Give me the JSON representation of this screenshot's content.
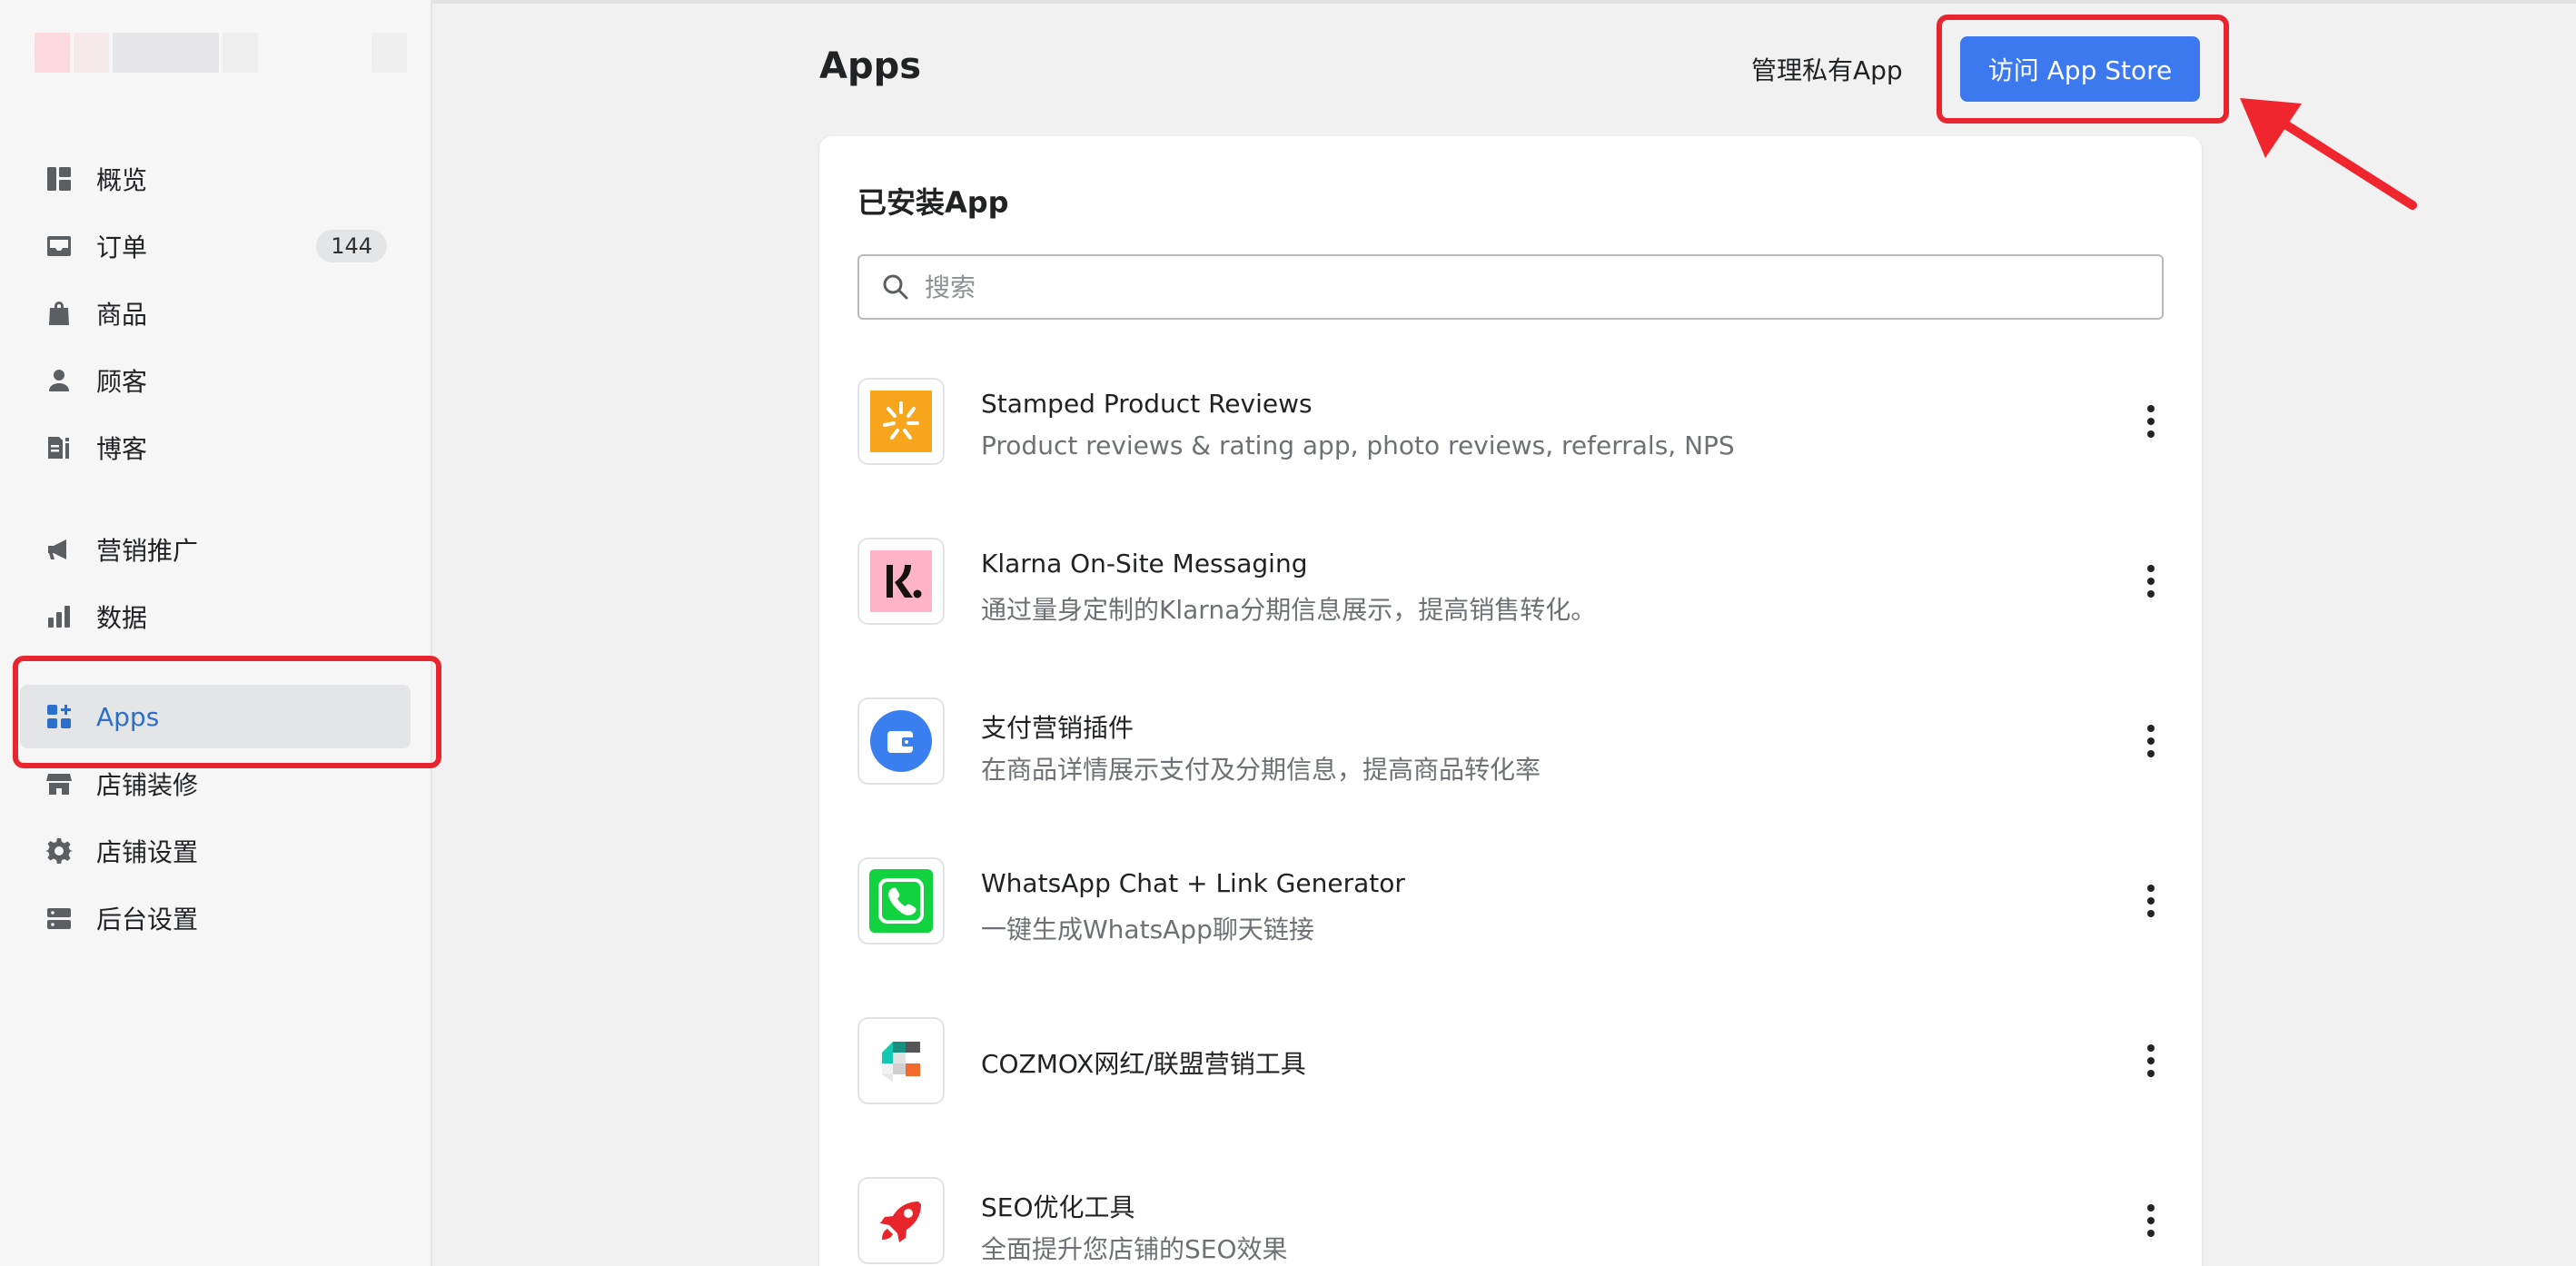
{
  "sidebar": {
    "items": [
      {
        "label": "概览",
        "icon": "overview-icon"
      },
      {
        "label": "订单",
        "icon": "inbox-icon",
        "badge": "144"
      },
      {
        "label": "商品",
        "icon": "shopping-bag-icon"
      },
      {
        "label": "顾客",
        "icon": "person-icon"
      },
      {
        "label": "博客",
        "icon": "blog-icon"
      },
      {
        "label": "营销推广",
        "icon": "megaphone-icon"
      },
      {
        "label": "数据",
        "icon": "bar-chart-icon"
      },
      {
        "label": "Apps",
        "icon": "apps-icon",
        "active": true
      },
      {
        "label": "店铺装修",
        "icon": "storefront-icon"
      },
      {
        "label": "店铺设置",
        "icon": "gear-icon"
      },
      {
        "label": "后台设置",
        "icon": "server-icon"
      }
    ]
  },
  "header": {
    "title": "Apps",
    "manage_link": "管理私有App",
    "store_button": "访问 App Store"
  },
  "installed": {
    "title": "已安装App",
    "search_placeholder": "搜索",
    "apps": [
      {
        "name": "Stamped Product Reviews",
        "desc": "Product reviews & rating app, photo reviews, referrals, NPS",
        "icon": "stamped-icon"
      },
      {
        "name": "Klarna On-Site Messaging",
        "desc": "通过量身定制的Klarna分期信息展示，提高销售转化。",
        "icon": "klarna-icon"
      },
      {
        "name": "支付营销插件",
        "desc": "在商品详情展示支付及分期信息，提高商品转化率",
        "icon": "wallet-icon"
      },
      {
        "name": "WhatsApp Chat + Link Generator",
        "desc": "一键生成WhatsApp聊天链接",
        "icon": "whatsapp-phone-icon"
      },
      {
        "name": "COZMOX网红/联盟营销工具",
        "desc": "",
        "icon": "cozmox-icon"
      },
      {
        "name": "SEO优化工具",
        "desc": "全面提升您店铺的SEO效果",
        "icon": "rocket-icon"
      }
    ]
  },
  "colors": {
    "accent": "#3c78ee",
    "highlight": "#e8262f",
    "active_text": "#2c6ecb"
  }
}
